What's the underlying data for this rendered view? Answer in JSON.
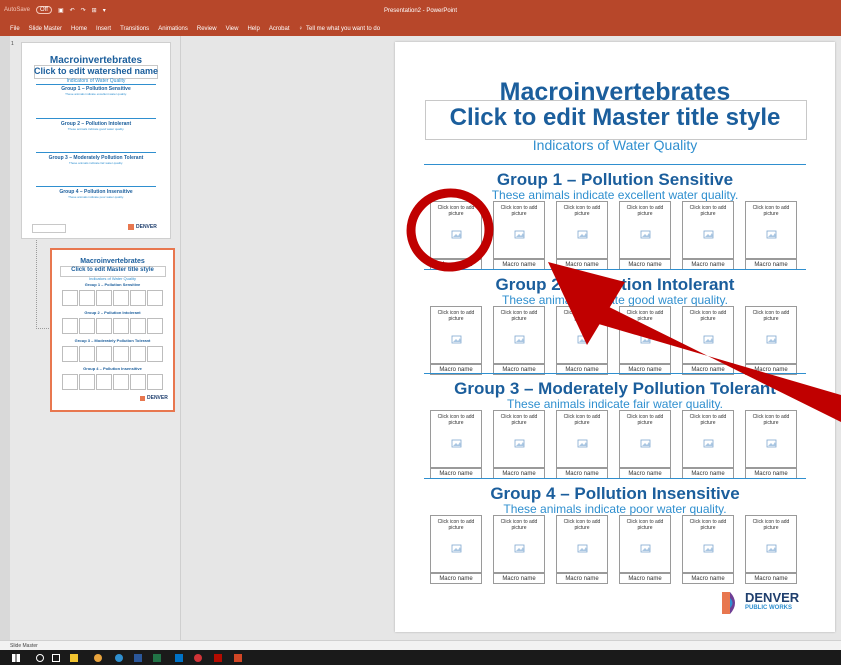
{
  "window": {
    "autosave_label": "AutoSave",
    "autosave_state": "Off",
    "title": "Presentation2 - PowerPoint"
  },
  "ribbon": {
    "tabs": [
      "File",
      "Slide Master",
      "Home",
      "Insert",
      "Transitions",
      "Animations",
      "Review",
      "View",
      "Help",
      "Acrobat"
    ],
    "tell_me": "Tell me what you want to do"
  },
  "thumbnails": {
    "index_label": "1",
    "thumb1": {
      "title1": "Macroinvertebrates",
      "title2": "Click to edit watershed name",
      "subtitle": "Indicators of Water Quality",
      "groups": [
        {
          "title": "Group 1 – Pollution Sensitive",
          "sub": "These animals indicate excellent water quality."
        },
        {
          "title": "Group 2 – Pollution Intolerant",
          "sub": "These animals indicate good water quality."
        },
        {
          "title": "Group 3 – Moderately Pollution Tolerant",
          "sub": "These animals indicate fair water quality."
        },
        {
          "title": "Group 4 – Pollution Insensitive",
          "sub": "These animals indicate poor water quality."
        }
      ],
      "logo": "DENVER"
    },
    "thumb2": {
      "title1": "Macroinvertebrates",
      "title2": "Click to edit Master title style",
      "subtitle": "Indicators of Water Quality",
      "groups": [
        "Group 1 – Pollution Sensitive",
        "Group 2 – Pollution Intolerant",
        "Group 3 – Moderately Pollution Tolerant",
        "Group 4 – Pollution Insensitive"
      ],
      "logo": "DENVER"
    }
  },
  "slide": {
    "title1": "Macroinvertebrates",
    "title2": "Click to edit Master title style",
    "subtitle": "Indicators of Water Quality",
    "placeholder_text": "Click icon to add picture",
    "name_label": "Macro name",
    "groups": [
      {
        "title": "Group 1 – Pollution Sensitive",
        "sub": "These animals indicate excellent water quality."
      },
      {
        "title": "Group 2 – Pollution Intolerant",
        "sub": "These animals indicate good water quality."
      },
      {
        "title": "Group 3 – Moderately Pollution Tolerant",
        "sub": "These animals indicate fair water quality."
      },
      {
        "title": "Group 4 – Pollution Insensitive",
        "sub": "These animals indicate poor water quality."
      }
    ],
    "logo_line1": "DENVER",
    "logo_line2": "PUBLIC WORKS"
  },
  "status": {
    "view": "Slide Master"
  },
  "colors": {
    "accent": "#b7472a",
    "title_blue": "#1b5e9c",
    "light_blue": "#2f8fcf",
    "annotation_red": "#c00000"
  }
}
